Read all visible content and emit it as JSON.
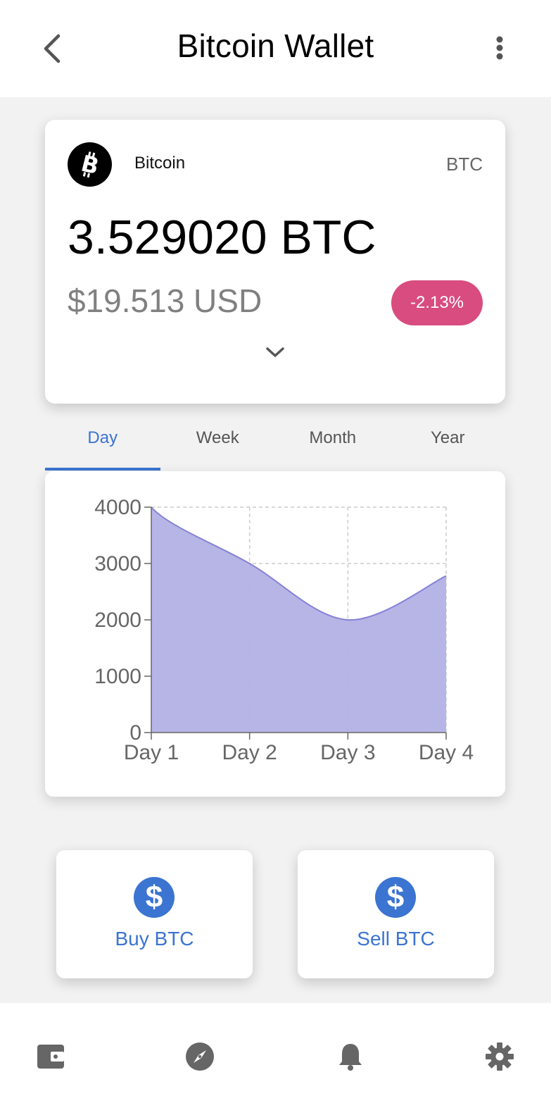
{
  "header": {
    "title": "Bitcoin Wallet"
  },
  "wallet": {
    "coin_name": "Bitcoin",
    "coin_symbol": "BTC",
    "balance": "3.529020 BTC",
    "fiat_value": "$19.513 USD",
    "change": "-2.13%"
  },
  "tabs": [
    {
      "label": "Day",
      "active": true
    },
    {
      "label": "Week",
      "active": false
    },
    {
      "label": "Month",
      "active": false
    },
    {
      "label": "Year",
      "active": false
    }
  ],
  "actions": {
    "buy_label": "Buy BTC",
    "sell_label": "Sell BTC"
  },
  "nav": {
    "icons": [
      "wallet-icon",
      "compass-icon",
      "bell-icon",
      "gear-icon"
    ]
  },
  "colors": {
    "accent": "#3b74d1",
    "negative_badge": "#d84c80",
    "chart_fill": "#b3b1e5",
    "chart_line": "#8682d6"
  },
  "chart_data": {
    "type": "area",
    "categories": [
      "Day 1",
      "Day 2",
      "Day 3",
      "Day 4"
    ],
    "values": [
      4000,
      3000,
      2000,
      2780
    ],
    "ylim": [
      0,
      4000
    ],
    "yticks": [
      0,
      1000,
      2000,
      3000,
      4000
    ],
    "grid": true,
    "title": "",
    "xlabel": "",
    "ylabel": ""
  }
}
